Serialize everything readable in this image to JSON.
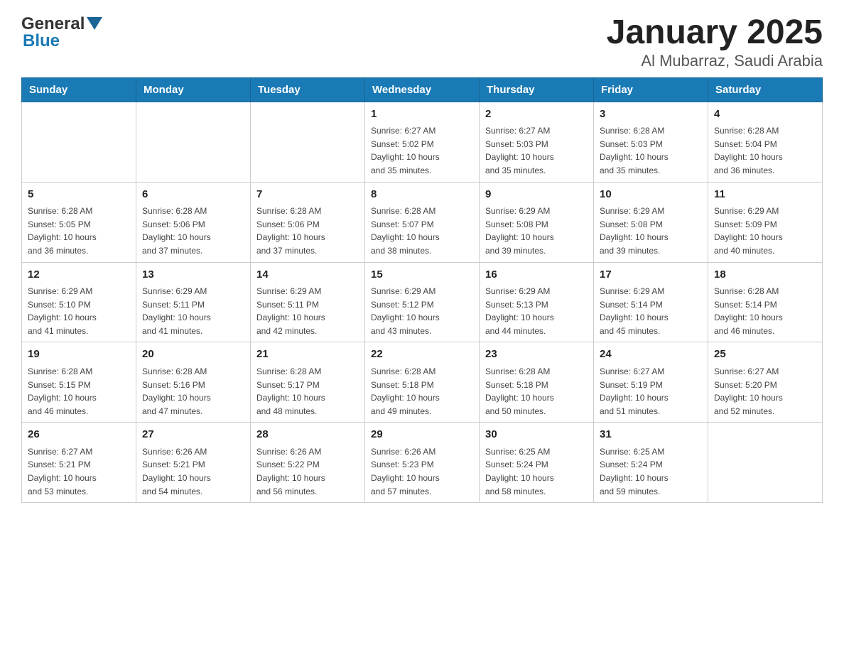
{
  "header": {
    "logo_general": "General",
    "logo_blue": "Blue",
    "title": "January 2025",
    "subtitle": "Al Mubarraz, Saudi Arabia"
  },
  "days_of_week": [
    "Sunday",
    "Monday",
    "Tuesday",
    "Wednesday",
    "Thursday",
    "Friday",
    "Saturday"
  ],
  "weeks": [
    [
      {
        "day": "",
        "info": ""
      },
      {
        "day": "",
        "info": ""
      },
      {
        "day": "",
        "info": ""
      },
      {
        "day": "1",
        "info": "Sunrise: 6:27 AM\nSunset: 5:02 PM\nDaylight: 10 hours\nand 35 minutes."
      },
      {
        "day": "2",
        "info": "Sunrise: 6:27 AM\nSunset: 5:03 PM\nDaylight: 10 hours\nand 35 minutes."
      },
      {
        "day": "3",
        "info": "Sunrise: 6:28 AM\nSunset: 5:03 PM\nDaylight: 10 hours\nand 35 minutes."
      },
      {
        "day": "4",
        "info": "Sunrise: 6:28 AM\nSunset: 5:04 PM\nDaylight: 10 hours\nand 36 minutes."
      }
    ],
    [
      {
        "day": "5",
        "info": "Sunrise: 6:28 AM\nSunset: 5:05 PM\nDaylight: 10 hours\nand 36 minutes."
      },
      {
        "day": "6",
        "info": "Sunrise: 6:28 AM\nSunset: 5:06 PM\nDaylight: 10 hours\nand 37 minutes."
      },
      {
        "day": "7",
        "info": "Sunrise: 6:28 AM\nSunset: 5:06 PM\nDaylight: 10 hours\nand 37 minutes."
      },
      {
        "day": "8",
        "info": "Sunrise: 6:28 AM\nSunset: 5:07 PM\nDaylight: 10 hours\nand 38 minutes."
      },
      {
        "day": "9",
        "info": "Sunrise: 6:29 AM\nSunset: 5:08 PM\nDaylight: 10 hours\nand 39 minutes."
      },
      {
        "day": "10",
        "info": "Sunrise: 6:29 AM\nSunset: 5:08 PM\nDaylight: 10 hours\nand 39 minutes."
      },
      {
        "day": "11",
        "info": "Sunrise: 6:29 AM\nSunset: 5:09 PM\nDaylight: 10 hours\nand 40 minutes."
      }
    ],
    [
      {
        "day": "12",
        "info": "Sunrise: 6:29 AM\nSunset: 5:10 PM\nDaylight: 10 hours\nand 41 minutes."
      },
      {
        "day": "13",
        "info": "Sunrise: 6:29 AM\nSunset: 5:11 PM\nDaylight: 10 hours\nand 41 minutes."
      },
      {
        "day": "14",
        "info": "Sunrise: 6:29 AM\nSunset: 5:11 PM\nDaylight: 10 hours\nand 42 minutes."
      },
      {
        "day": "15",
        "info": "Sunrise: 6:29 AM\nSunset: 5:12 PM\nDaylight: 10 hours\nand 43 minutes."
      },
      {
        "day": "16",
        "info": "Sunrise: 6:29 AM\nSunset: 5:13 PM\nDaylight: 10 hours\nand 44 minutes."
      },
      {
        "day": "17",
        "info": "Sunrise: 6:29 AM\nSunset: 5:14 PM\nDaylight: 10 hours\nand 45 minutes."
      },
      {
        "day": "18",
        "info": "Sunrise: 6:28 AM\nSunset: 5:14 PM\nDaylight: 10 hours\nand 46 minutes."
      }
    ],
    [
      {
        "day": "19",
        "info": "Sunrise: 6:28 AM\nSunset: 5:15 PM\nDaylight: 10 hours\nand 46 minutes."
      },
      {
        "day": "20",
        "info": "Sunrise: 6:28 AM\nSunset: 5:16 PM\nDaylight: 10 hours\nand 47 minutes."
      },
      {
        "day": "21",
        "info": "Sunrise: 6:28 AM\nSunset: 5:17 PM\nDaylight: 10 hours\nand 48 minutes."
      },
      {
        "day": "22",
        "info": "Sunrise: 6:28 AM\nSunset: 5:18 PM\nDaylight: 10 hours\nand 49 minutes."
      },
      {
        "day": "23",
        "info": "Sunrise: 6:28 AM\nSunset: 5:18 PM\nDaylight: 10 hours\nand 50 minutes."
      },
      {
        "day": "24",
        "info": "Sunrise: 6:27 AM\nSunset: 5:19 PM\nDaylight: 10 hours\nand 51 minutes."
      },
      {
        "day": "25",
        "info": "Sunrise: 6:27 AM\nSunset: 5:20 PM\nDaylight: 10 hours\nand 52 minutes."
      }
    ],
    [
      {
        "day": "26",
        "info": "Sunrise: 6:27 AM\nSunset: 5:21 PM\nDaylight: 10 hours\nand 53 minutes."
      },
      {
        "day": "27",
        "info": "Sunrise: 6:26 AM\nSunset: 5:21 PM\nDaylight: 10 hours\nand 54 minutes."
      },
      {
        "day": "28",
        "info": "Sunrise: 6:26 AM\nSunset: 5:22 PM\nDaylight: 10 hours\nand 56 minutes."
      },
      {
        "day": "29",
        "info": "Sunrise: 6:26 AM\nSunset: 5:23 PM\nDaylight: 10 hours\nand 57 minutes."
      },
      {
        "day": "30",
        "info": "Sunrise: 6:25 AM\nSunset: 5:24 PM\nDaylight: 10 hours\nand 58 minutes."
      },
      {
        "day": "31",
        "info": "Sunrise: 6:25 AM\nSunset: 5:24 PM\nDaylight: 10 hours\nand 59 minutes."
      },
      {
        "day": "",
        "info": ""
      }
    ]
  ]
}
